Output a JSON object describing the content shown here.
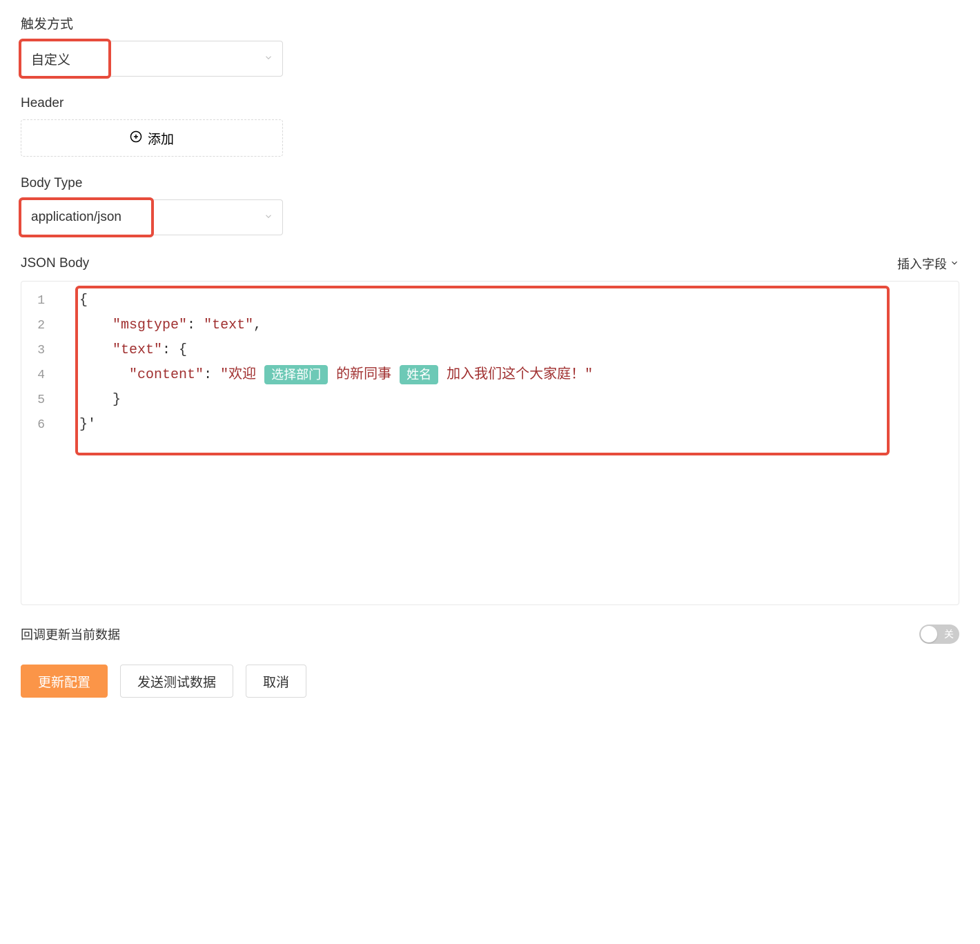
{
  "trigger": {
    "label": "触发方式",
    "value": "自定义"
  },
  "header": {
    "label": "Header",
    "add_label": "添加"
  },
  "body_type": {
    "label": "Body Type",
    "value": "application/json"
  },
  "json_body": {
    "label": "JSON Body",
    "insert_field_label": "插入字段",
    "lines": [
      "1",
      "2",
      "3",
      "4",
      "5",
      "6"
    ],
    "code": {
      "l1": "{",
      "l2_key": "\"msgtype\"",
      "l2_val": "\"text\"",
      "l3_key": "\"text\"",
      "l4_key": "\"content\"",
      "l4_prefix": "\"欢迎",
      "l4_chip1": "选择部门",
      "l4_mid": "的新同事",
      "l4_chip2": "姓名",
      "l4_suffix": "加入我们这个大家庭！\"",
      "l5": "}",
      "l6": "}'"
    }
  },
  "callback": {
    "label": "回调更新当前数据",
    "toggle_off_label": "关"
  },
  "footer": {
    "update_label": "更新配置",
    "send_test_label": "发送测试数据",
    "cancel_label": "取消"
  }
}
